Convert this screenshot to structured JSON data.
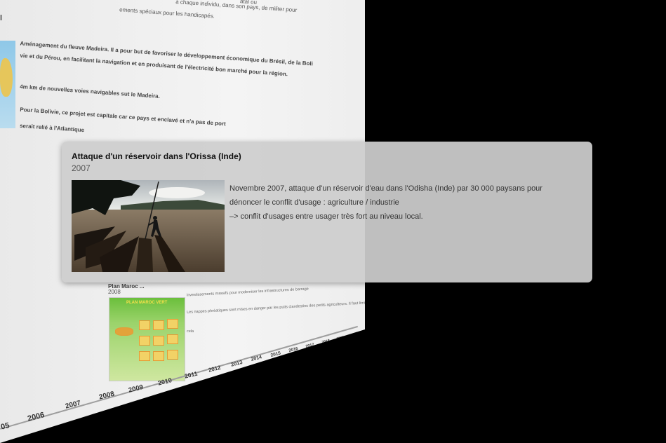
{
  "background_page": {
    "top_text_1": "à chaque individu, dans son pays, de militer pour",
    "top_text_2": "ements spéciaux pour les handicapés.",
    "top_right_fragment": "atal ou",
    "left_letter": "l",
    "madeira_p1_line1": "Aménagement du fleuve Madeira. Il a pour but de favoriser le développement économique du Brésil, de la Boli",
    "madeira_p1_line2": "vie et du Pérou, en facilitant la navigation et en produisant de l'électricité bon marché pour la région.",
    "madeira_p2": "4m km de nouvelles voies navigables sut le Madeira.",
    "madeira_p3_line1": "Pour la Bolivie, ce projet est capitale car ce pays et enclavé et n'a pas de port",
    "madeira_p3_line2": "serait relié à l'Atlantique",
    "plan_title": "Plan Maroc ...",
    "plan_year": "2008",
    "plan_text_1": "investissements massifs pour moderniser les infrastructures de barrage",
    "plan_text_2": "Les nappes phréatiques sont mises en danger par les puits clandestins des petits agriculteurs. Il faut limiter",
    "plan_text_3": "cela",
    "poster_heading": "PLAN MAROC VERT"
  },
  "timeline": {
    "years": [
      "05",
      "2006",
      "2007",
      "2008",
      "2009",
      "2010",
      "2011",
      "2012",
      "2013",
      "2014",
      "2015",
      "2016",
      "2017",
      "2018",
      "2019",
      "2020"
    ]
  },
  "card": {
    "title": "Attaque d'un réservoir dans l'Orissa (Inde)",
    "year": "2007",
    "description_lines": [
      "Novembre 2007, attaque d'un réservoir d'eau dans l'Odisha (Inde) par 30 000 paysans pour",
      "dénoncer le conflit d'usage : agriculture / industrie",
      " –> conflit d'usages entre usager très fort au niveau local."
    ]
  },
  "colors": {
    "screen_background": "#000000",
    "card_background": "#cdcdcd",
    "card_title": "#111111",
    "card_text": "#333333"
  }
}
